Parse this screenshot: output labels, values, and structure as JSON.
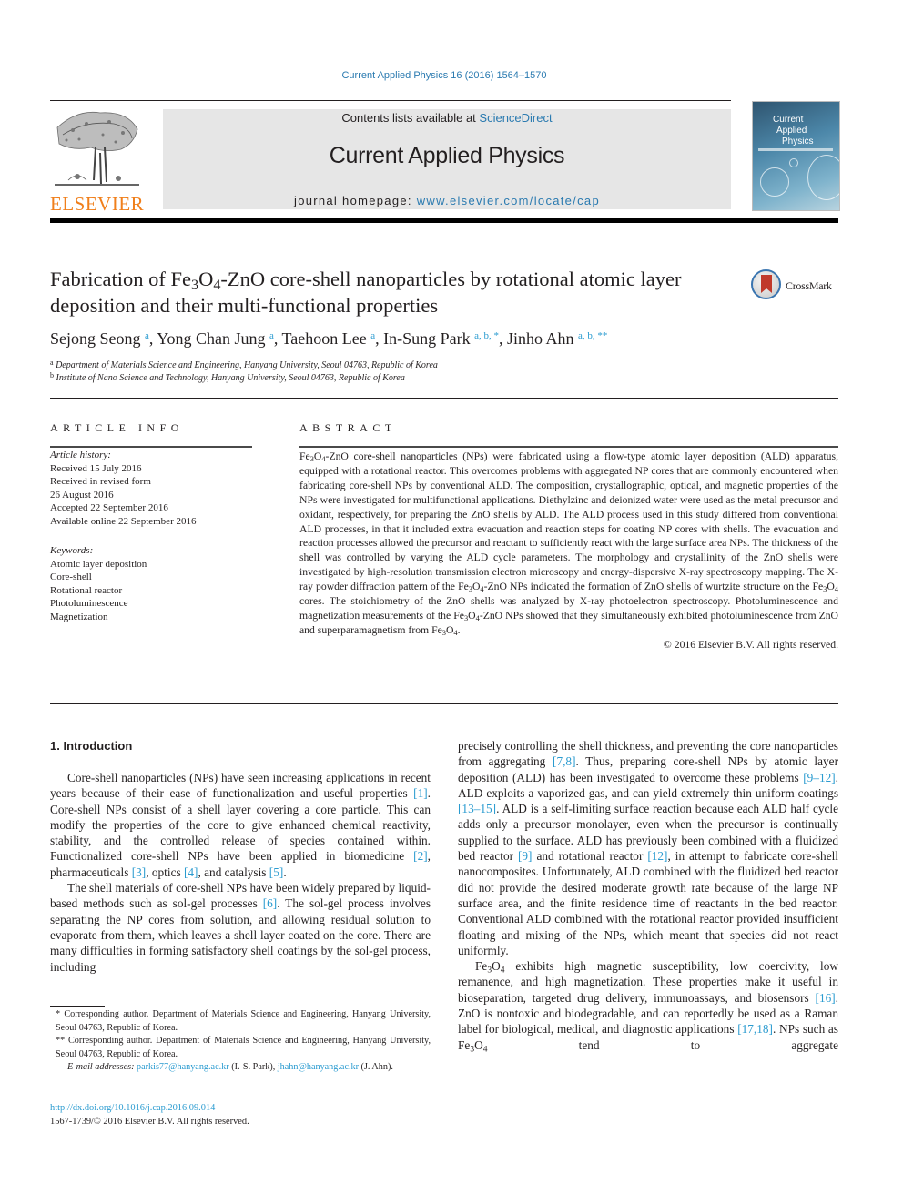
{
  "header": {
    "journal_ref": "Current Applied Physics 16 (2016) 1564–1570",
    "contents_prefix": "Contents lists available at ",
    "contents_link": "ScienceDirect",
    "journal_name": "Current Applied Physics",
    "homepage_prefix": "journal homepage: ",
    "homepage_link": "www.elsevier.com/locate/cap",
    "publisher_logo": "ELSEVIER",
    "cover": {
      "title_lines": [
        "Current",
        "Applied",
        "Physics"
      ]
    },
    "crossmark_label": "CrossMark"
  },
  "article": {
    "title_part1": "Fabrication of Fe",
    "title_sub1": "3",
    "title_part2": "O",
    "title_sub2": "4",
    "title_part3": "-ZnO core-shell nanoparticles by rotational atomic layer deposition and their multi-functional properties",
    "authors": [
      {
        "name": "Sejong Seong",
        "marks": "a"
      },
      {
        "name": "Yong Chan Jung",
        "marks": "a"
      },
      {
        "name": "Taehoon Lee",
        "marks": "a"
      },
      {
        "name": "In-Sung Park",
        "marks": "a, b, *"
      },
      {
        "name": "Jinho Ahn",
        "marks": "a, b, **"
      }
    ],
    "affiliations": [
      {
        "mark": "a",
        "text": "Department of Materials Science and Engineering, Hanyang University, Seoul 04763, Republic of Korea"
      },
      {
        "mark": "b",
        "text": "Institute of Nano Science and Technology, Hanyang University, Seoul 04763, Republic of Korea"
      }
    ]
  },
  "article_info": {
    "heading": "ARTICLE INFO",
    "history_label": "Article history:",
    "history": [
      "Received 15 July 2016",
      "Received in revised form",
      "26 August 2016",
      "Accepted 22 September 2016",
      "Available online 22 September 2016"
    ],
    "keywords_label": "Keywords:",
    "keywords": [
      "Atomic layer deposition",
      "Core-shell",
      "Rotational reactor",
      "Photoluminescence",
      "Magnetization"
    ]
  },
  "abstract": {
    "heading": "ABSTRACT",
    "s1": "-ZnO core-shell nanoparticles (NPs) were fabricated using a flow-type atomic layer deposition (ALD) apparatus, equipped with a rotational reactor. This overcomes problems with aggregated NP cores that are commonly encountered when fabricating core-shell NPs by conventional ALD. The composition, crystallographic, optical, and magnetic properties of the NPs were investigated for multifunctional applications. Diethylzinc and deionized water were used as the metal precursor and oxidant, respectively, for preparing the ZnO shells by ALD. The ALD process used in this study differed from conventional ALD processes, in that it included extra evacuation and reaction steps for coating NP cores with shells. The evacuation and reaction processes allowed the precursor and reactant to sufficiently react with the large surface area NPs. The thickness of the shell was controlled by varying the ALD cycle parameters. The morphology and crystallinity of the ZnO shells were investigated by high-resolution transmission electron microscopy and energy-dispersive X-ray spectroscopy mapping. The X-ray powder diffraction pattern of the ",
    "s2": "-ZnO NPs indicated the formation of ZnO shells of wurtzite structure on the ",
    "s3": " cores. The stoichiometry of the ZnO shells was analyzed by X-ray photoelectron spectroscopy. Photoluminescence and magnetization measurements of the ",
    "s4": "-ZnO NPs showed that they simultaneously exhibited photoluminescence from ZnO and superparamagnetism from ",
    "s5": ".",
    "copyright": "© 2016 Elsevier B.V. All rights reserved."
  },
  "body": {
    "intro_heading": "1.  Introduction",
    "p1": {
      "a": "Core-shell nanoparticles (NPs) have seen increasing applications in recent years because of their ease of functionalization and useful properties ",
      "c1": "[1]",
      "b": ". Core-shell NPs consist of a shell layer covering a core particle. This can modify the properties of the core to give enhanced chemical reactivity, stability, and the controlled release of species contained within. Functionalized core-shell NPs have been applied in biomedicine ",
      "c2": "[2]",
      "c": ", pharmaceuticals ",
      "c3": "[3]",
      "d": ", optics ",
      "c4": "[4]",
      "e": ", and catalysis ",
      "c5": "[5]",
      "f": "."
    },
    "p2": {
      "a": "The shell materials of core-shell NPs have been widely prepared by liquid-based methods such as sol-gel processes ",
      "c6": "[6]",
      "b": ". The sol-gel process involves separating the NP cores from solution, and allowing residual solution to evaporate from them, which leaves a shell layer coated on the core. There are many difficulties in forming satisfactory shell coatings by the sol-gel process, including"
    },
    "p3": {
      "a": "precisely controlling the shell thickness, and preventing the core nanoparticles from aggregating ",
      "c78": "[7,8]",
      "b": ". Thus, preparing core-shell NPs by atomic layer deposition (ALD) has been investigated to overcome these problems ",
      "c912": "[9–12]",
      "c": ". ALD exploits a vaporized gas, and can yield extremely thin uniform coatings ",
      "c1315": "[13–15]",
      "d": ". ALD is a self-limiting surface reaction because each ALD half cycle adds only a precursor monolayer, even when the precursor is continually supplied to the surface. ALD has previously been combined with a fluidized bed reactor ",
      "c9": "[9]",
      "e": " and rotational reactor ",
      "c12": "[12]",
      "f": ", in attempt to fabricate core-shell nanocomposites. Unfortunately, ALD combined with the fluidized bed reactor did not provide the desired moderate growth rate because of the large NP surface area, and the finite residence time of reactants in the bed reactor. Conventional ALD combined with the rotational reactor provided insufficient floating and mixing of the NPs, which meant that species did not react uniformly."
    },
    "p4": {
      "a": " exhibits high magnetic susceptibility, low coercivity, low remanence, and high magnetization. These properties make it useful in bioseparation, targeted drug delivery, immunoassays, and biosensors ",
      "c16": "[16]",
      "b": ". ZnO is nontoxic and biodegradable, and can reportedly be used as a Raman label for biological, medical, and diagnostic applications ",
      "c1718": "[17,18]",
      "c": ". NPs such as ",
      "d": " tend to aggregate"
    }
  },
  "chem": {
    "fe": "Fe",
    "three": "3",
    "o": "O",
    "four": "4"
  },
  "footnotes": {
    "star1": "* Corresponding author. Department of Materials Science and Engineering, Hanyang University, Seoul 04763, Republic of Korea.",
    "star2": "** Corresponding author. Department of Materials Science and Engineering, Hanyang University, Seoul 04763, Republic of Korea.",
    "email_label": "E-mail addresses: ",
    "email1": "parkis77@hanyang.ac.kr",
    "email1_owner": " (I.-S. Park), ",
    "email2": "jhahn@hanyang.ac.kr",
    "email2_owner": " (J. Ahn).",
    "doi": "http://dx.doi.org/10.1016/j.cap.2016.09.014",
    "issn": "1567-1739/© 2016 Elsevier B.V. All rights reserved."
  },
  "colors": {
    "link": "#2a7ab0",
    "citation": "#2a9bd0",
    "elsevier_orange": "#f07f1b",
    "masthead_bg": "#e6e6e6"
  }
}
